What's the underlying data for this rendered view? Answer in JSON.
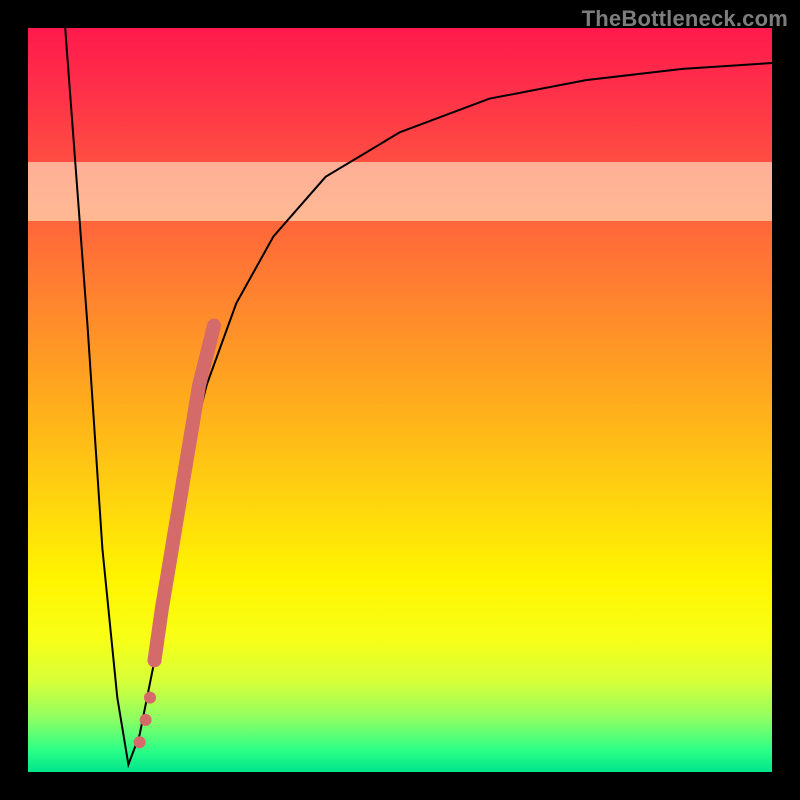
{
  "watermark": "TheBottleneck.com",
  "colors": {
    "frame": "#000000",
    "curve": "#000000",
    "marker": "#d46a6a",
    "band": "rgba(255,255,220,0.55)"
  },
  "chart_data": {
    "type": "line",
    "title": "",
    "xlabel": "",
    "ylabel": "",
    "xlim": [
      0,
      100
    ],
    "ylim": [
      0,
      100
    ],
    "grid": false,
    "legend": false,
    "series": [
      {
        "name": "bottleneck-curve",
        "x": [
          5,
          8,
          10,
          12,
          13.5,
          15,
          17,
          19,
          21,
          24,
          28,
          33,
          40,
          50,
          62,
          75,
          88,
          100
        ],
        "y": [
          100,
          60,
          30,
          10,
          1,
          5,
          15,
          28,
          40,
          52,
          63,
          72,
          80,
          86,
          90.5,
          93,
          94.5,
          95.3
        ]
      }
    ],
    "markers": [
      {
        "name": "highlight-segment",
        "x": [
          17,
          18,
          19,
          20,
          21,
          22,
          23,
          24,
          25
        ],
        "y": [
          15,
          22,
          28,
          34,
          40,
          46,
          52,
          56,
          60
        ],
        "style": "thick"
      },
      {
        "name": "dot-cluster",
        "x": [
          15,
          15.8,
          16.4
        ],
        "y": [
          4,
          7,
          10
        ],
        "style": "dots"
      }
    ],
    "highlight_band": {
      "y0": 74,
      "y1": 82
    }
  }
}
